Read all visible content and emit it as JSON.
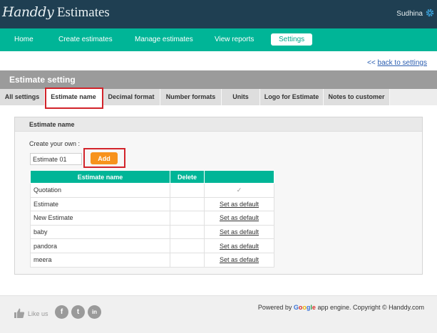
{
  "header": {
    "logo_script": "Handdy",
    "logo_plain": " Estimates",
    "user_name": "Sudhina"
  },
  "nav": {
    "items": [
      {
        "label": "Home"
      },
      {
        "label": "Create estimates"
      },
      {
        "label": "Manage estimates"
      },
      {
        "label": "View reports"
      },
      {
        "label": "Settings"
      }
    ],
    "active_label": "Settings"
  },
  "back_link": {
    "arrow": "<<",
    "label": "back to settings"
  },
  "section_title": "Estimate setting",
  "tabs": [
    {
      "label": "All settings"
    },
    {
      "label": "Estimate name"
    },
    {
      "label": "Decimal format"
    },
    {
      "label": "Number formats"
    },
    {
      "label": "Units"
    },
    {
      "label": "Logo for Estimate"
    },
    {
      "label": "Notes to customer"
    }
  ],
  "active_tab": "Estimate name",
  "panel": {
    "title": "Estimate name",
    "create_label": "Create your own :",
    "input_value": "Estimate 01",
    "add_label": "Add"
  },
  "table": {
    "headers": [
      "Estimate name",
      "Delete",
      ""
    ],
    "rows": [
      {
        "name": "Quotation",
        "delete": "",
        "action": "✓",
        "is_default": true
      },
      {
        "name": "Estimate",
        "delete": "",
        "action": "Set as default",
        "is_default": false
      },
      {
        "name": "New Estimate",
        "delete": "",
        "action": "Set as default",
        "is_default": false
      },
      {
        "name": "baby",
        "delete": "",
        "action": "Set as default",
        "is_default": false
      },
      {
        "name": "pandora",
        "delete": "",
        "action": "Set as default",
        "is_default": false
      },
      {
        "name": "meera",
        "delete": "",
        "action": "Set as default",
        "is_default": false
      }
    ]
  },
  "footer": {
    "like_text": "Like us",
    "social": [
      {
        "icon": "facebook-icon",
        "glyph": "f"
      },
      {
        "icon": "twitter-icon",
        "glyph": "t"
      },
      {
        "icon": "linkedin-icon",
        "glyph": "in"
      }
    ],
    "powered_prefix": "Powered by ",
    "google_letters": [
      "G",
      "o",
      "o",
      "g",
      "l",
      "e"
    ],
    "powered_suffix": " app engine. Copyright © Handdy.com"
  },
  "colors": {
    "topbar": "#1f3f52",
    "accent": "#00b597",
    "add_button": "#f7931d",
    "highlight_box": "#d2232a"
  }
}
